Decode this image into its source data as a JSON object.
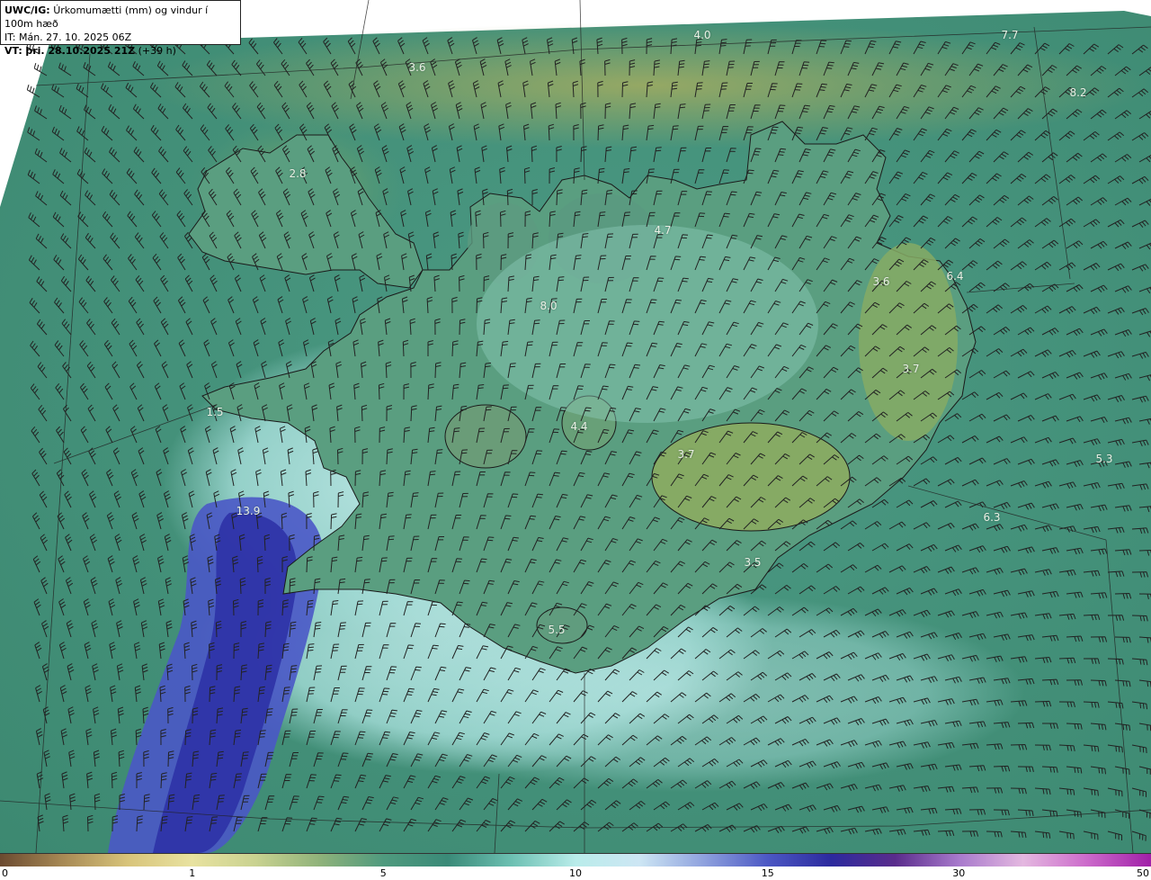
{
  "header": {
    "model": "UWC/IG:",
    "title": "Úrkomumætti (mm) og vindur í 100m hæð",
    "init_time": "IT: Mán. 27. 10. 2025 06Z",
    "valid_prefix": "VT:",
    "valid_time": "þri. 28.10.2025 21Z",
    "lead_time": "(+39 h)"
  },
  "map": {
    "colors": {
      "ocean_base": "#3f8a74",
      "ocean_light": "#56a08a",
      "highland": "#86a860",
      "yellow_band": "#9aa45c",
      "light_cyan": "#c0ecec",
      "pale": "#a8dad4",
      "blue": "#4050c8",
      "deep_blue": "#2a2c9c",
      "coast": "#1a1a1a",
      "barb": "#222222"
    },
    "value_labels": [
      "4.0",
      "7.7",
      "3.6",
      "8.2",
      "2.8",
      "4.7",
      "3.6",
      "6.4",
      "8.0",
      "3.7",
      "4.4",
      "3.7",
      "5.3",
      "13.9",
      "6.3",
      "3.5",
      "5.5",
      "1.5"
    ]
  },
  "colorbar": {
    "colors": [
      "#6b4a30",
      "#a88a55",
      "#d8c47a",
      "#e8e2a0",
      "#c9d290",
      "#8fb27a",
      "#4f9a7e",
      "#3a8a78",
      "#6cc0b2",
      "#b9ecea",
      "#cde6f4",
      "#8fa2de",
      "#4c58c4",
      "#2c2a9e",
      "#5a2c8c",
      "#a87acc",
      "#e4b8e0",
      "#cc6acb",
      "#a020a8"
    ],
    "ticks": [
      "0",
      "1",
      "5",
      "10",
      "15",
      "30",
      "50"
    ],
    "tick_positions": [
      0,
      0.167,
      0.333,
      0.5,
      0.667,
      0.833,
      1
    ]
  }
}
